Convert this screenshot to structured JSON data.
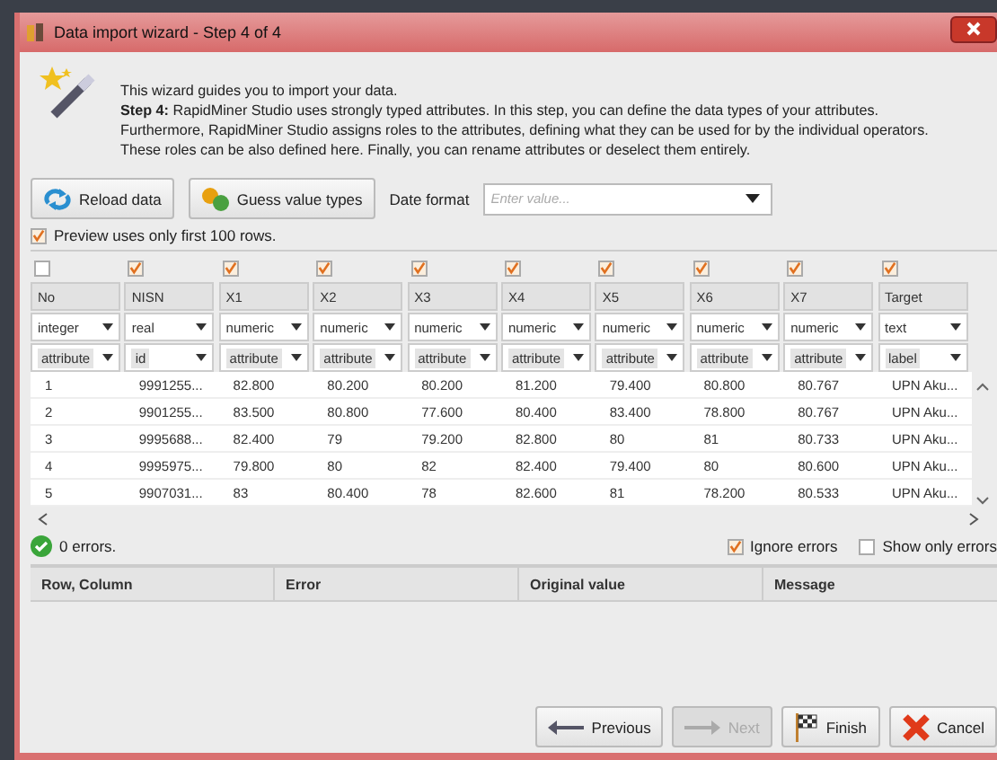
{
  "window": {
    "title": "Data import wizard - Step 4 of 4"
  },
  "intro": {
    "line": "This wizard guides you to import your data.",
    "text": "**Step 4:** RapidMiner Studio uses strongly typed attributes. In this step, you can define the data types of your attributes. Furthermore, RapidMiner Studio assigns roles to the attributes, defining what they can be used for by the individual operators. These roles can be also defined here. Finally, you can rename attributes or deselect them entirely."
  },
  "toolbar": {
    "reload": "Reload data",
    "guess": "Guess value types",
    "date_label": "Date format",
    "date_placeholder": "Enter value..."
  },
  "preview": {
    "label": "Preview uses only first 100 rows.",
    "checked": true
  },
  "columns": [
    {
      "name": "No",
      "checked": false,
      "type": "integer",
      "role": "attribute"
    },
    {
      "name": "NISN",
      "checked": true,
      "type": "real",
      "role": "id"
    },
    {
      "name": "X1",
      "checked": true,
      "type": "numeric",
      "role": "attribute"
    },
    {
      "name": "X2",
      "checked": true,
      "type": "numeric",
      "role": "attribute"
    },
    {
      "name": "X3",
      "checked": true,
      "type": "numeric",
      "role": "attribute"
    },
    {
      "name": "X4",
      "checked": true,
      "type": "numeric",
      "role": "attribute"
    },
    {
      "name": "X5",
      "checked": true,
      "type": "numeric",
      "role": "attribute"
    },
    {
      "name": "X6",
      "checked": true,
      "type": "numeric",
      "role": "attribute"
    },
    {
      "name": "X7",
      "checked": true,
      "type": "numeric",
      "role": "attribute"
    },
    {
      "name": "Target",
      "checked": true,
      "type": "text",
      "role": "label"
    }
  ],
  "rows": [
    [
      "1",
      "9991255...",
      "82.800",
      "80.200",
      "80.200",
      "81.200",
      "79.400",
      "80.800",
      "80.767",
      "UPN Aku..."
    ],
    [
      "2",
      "9901255...",
      "83.500",
      "80.800",
      "77.600",
      "80.400",
      "83.400",
      "78.800",
      "80.767",
      "UPN Aku..."
    ],
    [
      "3",
      "9995688...",
      "82.400",
      "79",
      "79.200",
      "82.800",
      "80",
      "81",
      "80.733",
      "UPN Aku..."
    ],
    [
      "4",
      "9995975...",
      "79.800",
      "80",
      "82",
      "82.400",
      "79.400",
      "80",
      "80.600",
      "UPN Aku..."
    ],
    [
      "5",
      "9907031...",
      "83",
      "80.400",
      "78",
      "82.600",
      "81",
      "78.200",
      "80.533",
      "UPN Aku..."
    ]
  ],
  "status": {
    "errors": "0 errors.",
    "ignore_label": "Ignore errors",
    "ignore_checked": true,
    "only_label": "Show only errors",
    "only_checked": false
  },
  "error_table": {
    "columns": [
      "Row, Column",
      "Error",
      "Original value",
      "Message"
    ]
  },
  "buttons": [
    {
      "kind": "previous",
      "label": "Previous",
      "disabled": false
    },
    {
      "kind": "next",
      "label": "Next",
      "disabled": true
    },
    {
      "kind": "finish",
      "label": "Finish",
      "disabled": false
    },
    {
      "kind": "cancel",
      "label": "Cancel",
      "disabled": false
    }
  ]
}
